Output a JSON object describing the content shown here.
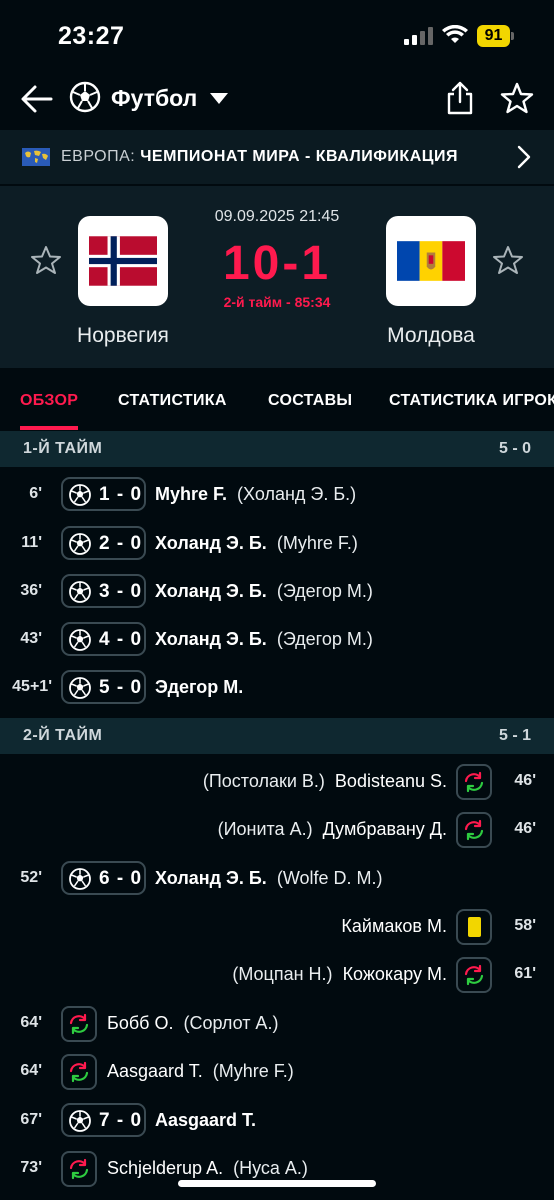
{
  "status_bar": {
    "time": "23:27",
    "battery": "91"
  },
  "header": {
    "sport": "Футбол",
    "sport_icon": "soccer-ball-icon"
  },
  "league": {
    "region": "ЕВРОПА:",
    "name": "ЧЕМПИОНАТ МИРА - КВАЛИФИКАЦИЯ"
  },
  "match": {
    "date": "09.09.2025 21:45",
    "score": "10-1",
    "status": "2-й тайм - 85:34",
    "home_team": "Норвегия",
    "away_team": "Молдова"
  },
  "tabs": [
    "ОБЗОР",
    "СТАТИСТИКА",
    "СОСТАВЫ",
    "СТАТИСТИКА ИГРОКОВ"
  ],
  "first_half": {
    "label": "1-Й ТАЙМ",
    "score": "5 - 0",
    "events": [
      {
        "minute": "6'",
        "score": "1 - 0",
        "player": "Myhre F.",
        "assist": "(Холанд Э. Б.)"
      },
      {
        "minute": "11'",
        "score": "2 - 0",
        "player": "Холанд Э. Б.",
        "assist": "(Myhre F.)"
      },
      {
        "minute": "36'",
        "score": "3 - 0",
        "player": "Холанд Э. Б.",
        "assist": "(Эдегор М.)"
      },
      {
        "minute": "43'",
        "score": "4 - 0",
        "player": "Холанд Э. Б.",
        "assist": "(Эдегор М.)"
      },
      {
        "minute": "45+1'",
        "score": "5 - 0",
        "player": "Эдегор М.",
        "assist": ""
      }
    ]
  },
  "second_half": {
    "label": "2-Й ТАЙМ",
    "score": "5 - 1",
    "events": [
      {
        "minute": "46'",
        "player_in": "Bodisteanu S.",
        "player_out": "(Постолаки В.)"
      },
      {
        "minute": "46'",
        "player_in": "Думбравану Д.",
        "player_out": "(Ионита А.)"
      },
      {
        "minute": "52'",
        "score": "6 - 0",
        "player": "Холанд Э. Б.",
        "assist": "(Wolfe D. M.)"
      },
      {
        "minute": "58'",
        "player": "Каймаков М."
      },
      {
        "minute": "61'",
        "player_in": "Кожокару М.",
        "player_out": "(Моцпан Н.)"
      },
      {
        "minute": "64'",
        "player_in": "Бобб О.",
        "player_out": "(Сорлот А.)"
      },
      {
        "minute": "64'",
        "player_in": "Aasgaard T.",
        "player_out": "(Myhre F.)"
      },
      {
        "minute": "67'",
        "score": "7 - 0",
        "player": "Aasgaard T.",
        "assist": ""
      },
      {
        "minute": "73'",
        "player_in": "Schjelderup A.",
        "player_out": "(Нуса А.)"
      }
    ]
  },
  "colors": {
    "accent": "#ff1a4e",
    "background": "#010a0f",
    "header_panel": "#0d1d25",
    "section_header": "#0f2830",
    "yellow_card": "#f2d600",
    "substitution_in": "#2ecc40",
    "substitution_out": "#ff1a4e"
  }
}
